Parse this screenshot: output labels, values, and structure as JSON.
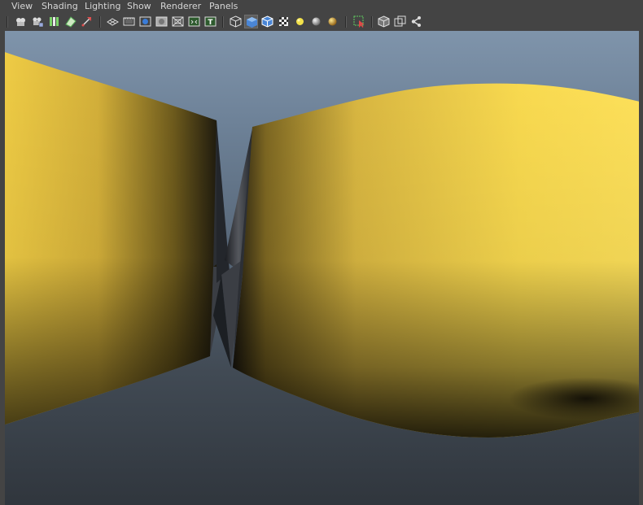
{
  "menubar": {
    "items": [
      {
        "label": "View"
      },
      {
        "label": "Shading"
      },
      {
        "label": "Lighting"
      },
      {
        "label": "Show"
      },
      {
        "label": "Renderer"
      },
      {
        "label": "Panels"
      }
    ]
  },
  "toolbar": {
    "groups": [
      [
        "select-camera-icon",
        "camera-attributes-icon",
        "bookmarks-icon",
        "image-plane-icon",
        "2d-pan-zoom-icon"
      ],
      [
        "grid-icon",
        "film-gate-icon",
        "resolution-gate-icon",
        "gate-mask-icon",
        "field-chart-icon",
        "safe-action-icon",
        "safe-title-icon"
      ],
      [
        "wireframe-icon",
        "smooth-shade-icon",
        "wireframe-on-shaded-icon",
        "textured-icon",
        "use-default-light-icon",
        "shadows-icon",
        "ambient-occlusion-icon"
      ],
      [
        "isolate-select-icon"
      ],
      [
        "xray-icon",
        "xray-active-components-icon",
        "xray-joints-icon"
      ]
    ],
    "active": [
      "smooth-shade-icon"
    ]
  },
  "colors": {
    "chrome": "#444444",
    "menu_text": "#d6d6d6",
    "viewport_top": "#7f94ab",
    "viewport_bottom": "#30363d",
    "mesh_yellow": "#f5d24a",
    "mesh_shadow": "#1c1a12",
    "seam_dark": "#2a2d33"
  }
}
